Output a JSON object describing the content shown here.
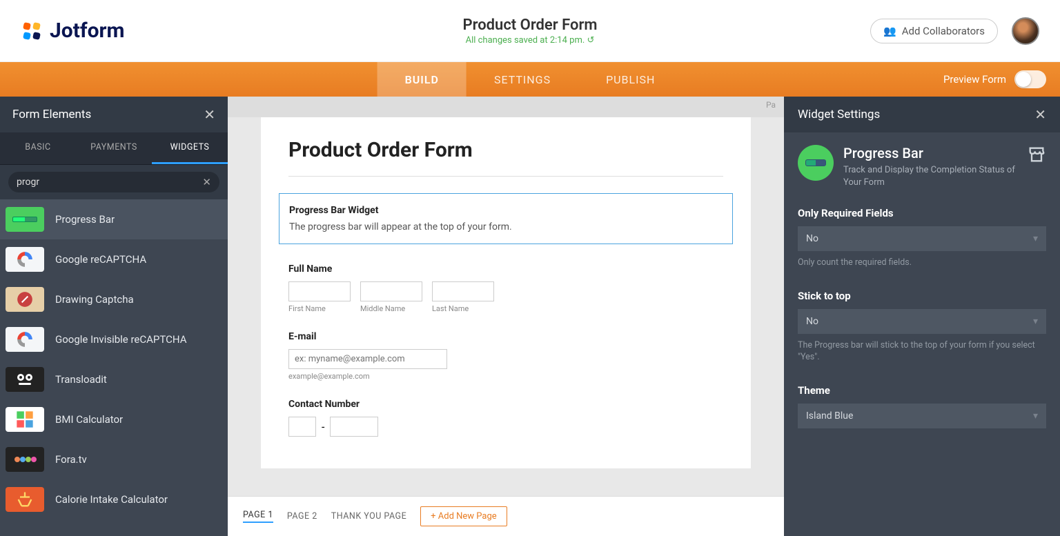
{
  "brand": "Jotform",
  "header": {
    "title": "Product Order Form",
    "save_status": "All changes saved at 2:14 pm. ↺",
    "collab_label": "Add Collaborators"
  },
  "nav": {
    "tabs": {
      "build": "BUILD",
      "settings": "SETTINGS",
      "publish": "PUBLISH"
    },
    "preview_label": "Preview Form"
  },
  "left": {
    "title": "Form Elements",
    "tabs": {
      "basic": "BASIC",
      "payments": "PAYMENTS",
      "widgets": "WIDGETS"
    },
    "search_value": "progr",
    "widgets": [
      {
        "name": "Progress Bar"
      },
      {
        "name": "Google reCAPTCHA"
      },
      {
        "name": "Drawing Captcha"
      },
      {
        "name": "Google Invisible reCAPTCHA"
      },
      {
        "name": "Transloadit"
      },
      {
        "name": "BMI Calculator"
      },
      {
        "name": "Fora.tv"
      },
      {
        "name": "Calorie Intake Calculator"
      }
    ]
  },
  "canvas": {
    "corner_hint": "Pa",
    "form_title": "Product Order Form",
    "widget_block": {
      "title": "Progress Bar Widget",
      "desc": "The progress bar will appear at the top of your form."
    },
    "fields": {
      "fullname": {
        "label": "Full Name",
        "sub": {
          "first": "First Name",
          "middle": "Middle Name",
          "last": "Last Name"
        }
      },
      "email": {
        "label": "E-mail",
        "placeholder": "ex: myname@example.com",
        "sublabel": "example@example.com"
      },
      "contact": {
        "label": "Contact Number"
      }
    },
    "page_tabs": {
      "p1": "PAGE 1",
      "p2": "PAGE 2",
      "thanks": "THANK YOU PAGE",
      "add": "+ Add New Page"
    }
  },
  "right": {
    "title": "Widget Settings",
    "widget": {
      "name": "Progress Bar",
      "desc": "Track and Display the Completion Status of Your Form"
    },
    "fields": {
      "required": {
        "label": "Only Required Fields",
        "value": "No",
        "hint": "Only count the required fields."
      },
      "stick": {
        "label": "Stick to top",
        "value": "No",
        "hint": "The Progress bar will stick to the top of your form if you select \"Yes\"."
      },
      "theme": {
        "label": "Theme",
        "value": "Island Blue"
      }
    }
  }
}
